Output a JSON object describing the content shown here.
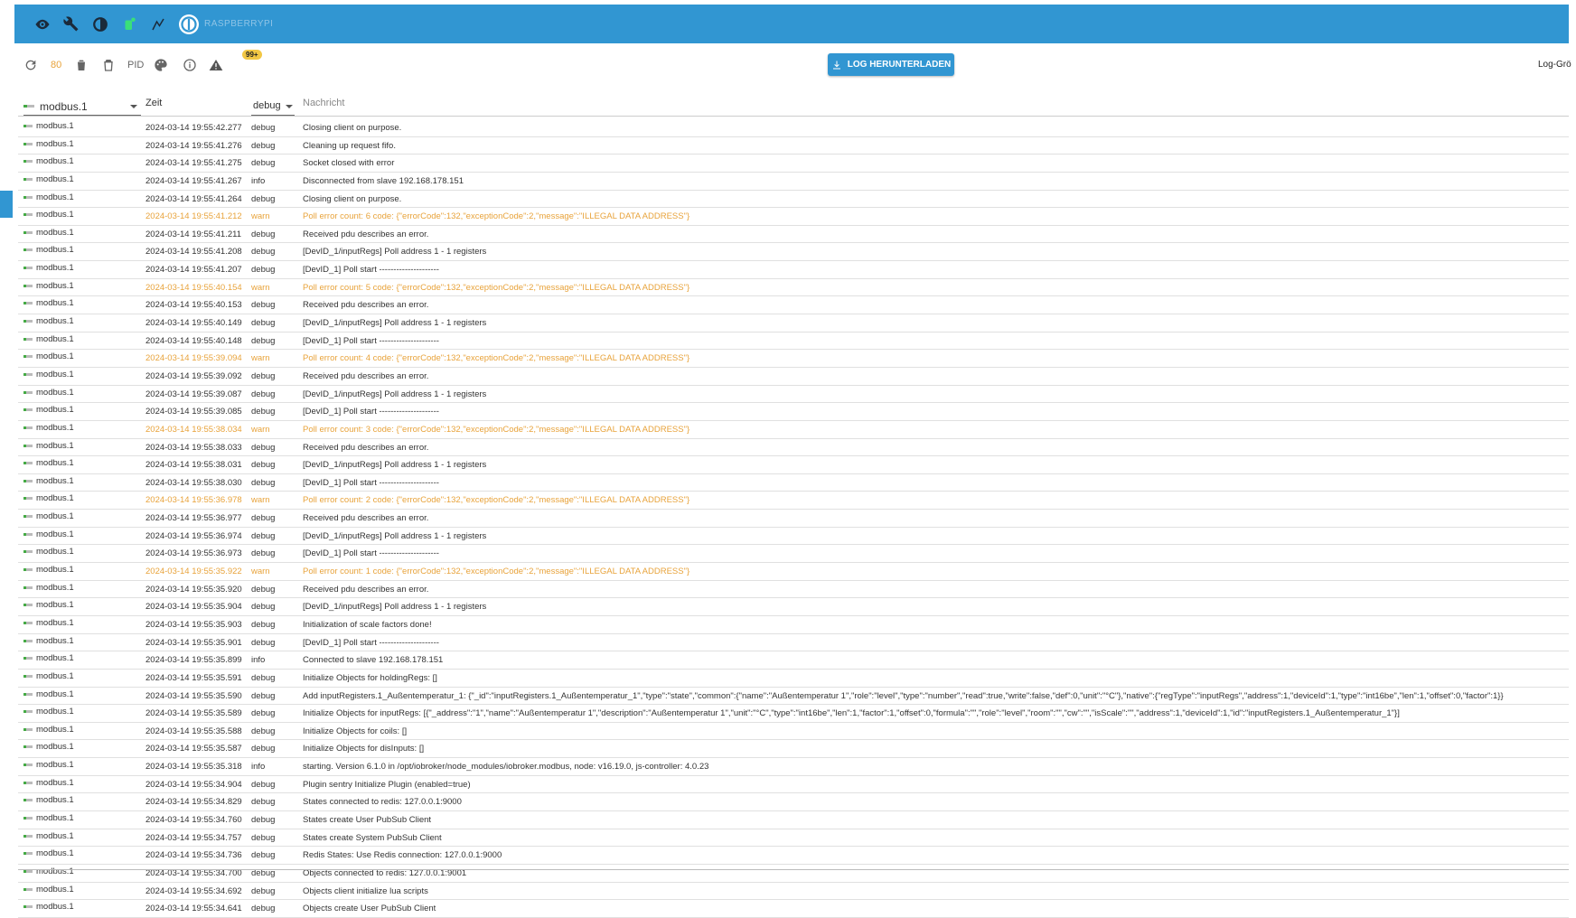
{
  "topbar": {
    "host_name": "RASPBERRYPI",
    "icons": [
      "eye-icon",
      "wrench-icon",
      "contrast-icon",
      "notification-icon",
      "expert-mode-icon",
      "host-logo-icon"
    ]
  },
  "toolbar": {
    "refresh_icon": "refresh-icon",
    "count": "80",
    "delete_icon": "trash-icon",
    "delete_all_icon": "trash-all-icon",
    "pid_label": "PID",
    "palette_icon": "palette-icon",
    "info_icon": "info-icon",
    "warn_icon": "warning-icon",
    "warn_badge": "99+",
    "download_label": "LOG HERUNTERLADEN",
    "log_size_label": "Log-Grö"
  },
  "header": {
    "source_value": "modbus.1",
    "time_label": "Zeit",
    "level_value": "debug",
    "message_placeholder": "Nachricht"
  },
  "colors": {
    "accent": "#3196d2",
    "warn": "#e8a33b",
    "badge": "#f2c744"
  },
  "rows": [
    {
      "src": "modbus.1",
      "time": "2024-03-14 19:55:42.277",
      "lvl": "debug",
      "msg": "Closing client on purpose."
    },
    {
      "src": "modbus.1",
      "time": "2024-03-14 19:55:41.276",
      "lvl": "debug",
      "msg": "Cleaning up request fifo."
    },
    {
      "src": "modbus.1",
      "time": "2024-03-14 19:55:41.275",
      "lvl": "debug",
      "msg": "Socket closed with error"
    },
    {
      "src": "modbus.1",
      "time": "2024-03-14 19:55:41.267",
      "lvl": "info",
      "msg": "Disconnected from slave 192.168.178.151"
    },
    {
      "src": "modbus.1",
      "time": "2024-03-14 19:55:41.264",
      "lvl": "debug",
      "msg": "Closing client on purpose."
    },
    {
      "src": "modbus.1",
      "time": "2024-03-14 19:55:41.212",
      "lvl": "warn",
      "msg": "Poll error count: 6 code: {\"errorCode\":132,\"exceptionCode\":2,\"message\":\"ILLEGAL DATA ADDRESS\"}"
    },
    {
      "src": "modbus.1",
      "time": "2024-03-14 19:55:41.211",
      "lvl": "debug",
      "msg": "Received pdu describes an error."
    },
    {
      "src": "modbus.1",
      "time": "2024-03-14 19:55:41.208",
      "lvl": "debug",
      "msg": "[DevID_1/inputRegs] Poll address 1 - 1 registers"
    },
    {
      "src": "modbus.1",
      "time": "2024-03-14 19:55:41.207",
      "lvl": "debug",
      "msg": "[DevID_1] Poll start ---------------------"
    },
    {
      "src": "modbus.1",
      "time": "2024-03-14 19:55:40.154",
      "lvl": "warn",
      "msg": "Poll error count: 5 code: {\"errorCode\":132,\"exceptionCode\":2,\"message\":\"ILLEGAL DATA ADDRESS\"}"
    },
    {
      "src": "modbus.1",
      "time": "2024-03-14 19:55:40.153",
      "lvl": "debug",
      "msg": "Received pdu describes an error."
    },
    {
      "src": "modbus.1",
      "time": "2024-03-14 19:55:40.149",
      "lvl": "debug",
      "msg": "[DevID_1/inputRegs] Poll address 1 - 1 registers"
    },
    {
      "src": "modbus.1",
      "time": "2024-03-14 19:55:40.148",
      "lvl": "debug",
      "msg": "[DevID_1] Poll start ---------------------"
    },
    {
      "src": "modbus.1",
      "time": "2024-03-14 19:55:39.094",
      "lvl": "warn",
      "msg": "Poll error count: 4 code: {\"errorCode\":132,\"exceptionCode\":2,\"message\":\"ILLEGAL DATA ADDRESS\"}"
    },
    {
      "src": "modbus.1",
      "time": "2024-03-14 19:55:39.092",
      "lvl": "debug",
      "msg": "Received pdu describes an error."
    },
    {
      "src": "modbus.1",
      "time": "2024-03-14 19:55:39.087",
      "lvl": "debug",
      "msg": "[DevID_1/inputRegs] Poll address 1 - 1 registers"
    },
    {
      "src": "modbus.1",
      "time": "2024-03-14 19:55:39.085",
      "lvl": "debug",
      "msg": "[DevID_1] Poll start ---------------------"
    },
    {
      "src": "modbus.1",
      "time": "2024-03-14 19:55:38.034",
      "lvl": "warn",
      "msg": "Poll error count: 3 code: {\"errorCode\":132,\"exceptionCode\":2,\"message\":\"ILLEGAL DATA ADDRESS\"}"
    },
    {
      "src": "modbus.1",
      "time": "2024-03-14 19:55:38.033",
      "lvl": "debug",
      "msg": "Received pdu describes an error."
    },
    {
      "src": "modbus.1",
      "time": "2024-03-14 19:55:38.031",
      "lvl": "debug",
      "msg": "[DevID_1/inputRegs] Poll address 1 - 1 registers"
    },
    {
      "src": "modbus.1",
      "time": "2024-03-14 19:55:38.030",
      "lvl": "debug",
      "msg": "[DevID_1] Poll start ---------------------"
    },
    {
      "src": "modbus.1",
      "time": "2024-03-14 19:55:36.978",
      "lvl": "warn",
      "msg": "Poll error count: 2 code: {\"errorCode\":132,\"exceptionCode\":2,\"message\":\"ILLEGAL DATA ADDRESS\"}"
    },
    {
      "src": "modbus.1",
      "time": "2024-03-14 19:55:36.977",
      "lvl": "debug",
      "msg": "Received pdu describes an error."
    },
    {
      "src": "modbus.1",
      "time": "2024-03-14 19:55:36.974",
      "lvl": "debug",
      "msg": "[DevID_1/inputRegs] Poll address 1 - 1 registers"
    },
    {
      "src": "modbus.1",
      "time": "2024-03-14 19:55:36.973",
      "lvl": "debug",
      "msg": "[DevID_1] Poll start ---------------------"
    },
    {
      "src": "modbus.1",
      "time": "2024-03-14 19:55:35.922",
      "lvl": "warn",
      "msg": "Poll error count: 1 code: {\"errorCode\":132,\"exceptionCode\":2,\"message\":\"ILLEGAL DATA ADDRESS\"}"
    },
    {
      "src": "modbus.1",
      "time": "2024-03-14 19:55:35.920",
      "lvl": "debug",
      "msg": "Received pdu describes an error."
    },
    {
      "src": "modbus.1",
      "time": "2024-03-14 19:55:35.904",
      "lvl": "debug",
      "msg": "[DevID_1/inputRegs] Poll address 1 - 1 registers"
    },
    {
      "src": "modbus.1",
      "time": "2024-03-14 19:55:35.903",
      "lvl": "debug",
      "msg": "Initialization of scale factors done!"
    },
    {
      "src": "modbus.1",
      "time": "2024-03-14 19:55:35.901",
      "lvl": "debug",
      "msg": "[DevID_1] Poll start ---------------------"
    },
    {
      "src": "modbus.1",
      "time": "2024-03-14 19:55:35.899",
      "lvl": "info",
      "msg": "Connected to slave 192.168.178.151"
    },
    {
      "src": "modbus.1",
      "time": "2024-03-14 19:55:35.591",
      "lvl": "debug",
      "msg": "Initialize Objects for holdingRegs: []"
    },
    {
      "src": "modbus.1",
      "time": "2024-03-14 19:55:35.590",
      "lvl": "debug",
      "msg": "Add inputRegisters.1_Außentemperatur_1: {\"_id\":\"inputRegisters.1_Außentemperatur_1\",\"type\":\"state\",\"common\":{\"name\":\"Außentemperatur 1\",\"role\":\"level\",\"type\":\"number\",\"read\":true,\"write\":false,\"def\":0,\"unit\":\"°C\"},\"native\":{\"regType\":\"inputRegs\",\"address\":1,\"deviceId\":1,\"type\":\"int16be\",\"len\":1,\"offset\":0,\"factor\":1}}"
    },
    {
      "src": "modbus.1",
      "time": "2024-03-14 19:55:35.589",
      "lvl": "debug",
      "msg": "Initialize Objects for inputRegs: [{\"_address\":\"1\",\"name\":\"Außentemperatur 1\",\"description\":\"Außentemperatur 1\",\"unit\":\"°C\",\"type\":\"int16be\",\"len\":1,\"factor\":1,\"offset\":0,\"formula\":\"\",\"role\":\"level\",\"room\":\"\",\"cw\":\"\",\"isScale\":\"\",\"address\":1,\"deviceId\":1,\"id\":\"inputRegisters.1_Außentemperatur_1\"}]"
    },
    {
      "src": "modbus.1",
      "time": "2024-03-14 19:55:35.588",
      "lvl": "debug",
      "msg": "Initialize Objects for coils: []"
    },
    {
      "src": "modbus.1",
      "time": "2024-03-14 19:55:35.587",
      "lvl": "debug",
      "msg": "Initialize Objects for disInputs: []"
    },
    {
      "src": "modbus.1",
      "time": "2024-03-14 19:55:35.318",
      "lvl": "info",
      "msg": "starting. Version 6.1.0 in /opt/iobroker/node_modules/iobroker.modbus, node: v16.19.0, js-controller: 4.0.23"
    },
    {
      "src": "modbus.1",
      "time": "2024-03-14 19:55:34.904",
      "lvl": "debug",
      "msg": "Plugin sentry Initialize Plugin (enabled=true)"
    },
    {
      "src": "modbus.1",
      "time": "2024-03-14 19:55:34.829",
      "lvl": "debug",
      "msg": "States connected to redis: 127.0.0.1:9000"
    },
    {
      "src": "modbus.1",
      "time": "2024-03-14 19:55:34.760",
      "lvl": "debug",
      "msg": "States create User PubSub Client"
    },
    {
      "src": "modbus.1",
      "time": "2024-03-14 19:55:34.757",
      "lvl": "debug",
      "msg": "States create System PubSub Client"
    },
    {
      "src": "modbus.1",
      "time": "2024-03-14 19:55:34.736",
      "lvl": "debug",
      "msg": "Redis States: Use Redis connection: 127.0.0.1:9000"
    },
    {
      "src": "modbus.1",
      "time": "2024-03-14 19:55:34.700",
      "lvl": "debug",
      "msg": "Objects connected to redis: 127.0.0.1:9001"
    },
    {
      "src": "modbus.1",
      "time": "2024-03-14 19:55:34.692",
      "lvl": "debug",
      "msg": "Objects client initialize lua scripts"
    },
    {
      "src": "modbus.1",
      "time": "2024-03-14 19:55:34.641",
      "lvl": "debug",
      "msg": "Objects create User PubSub Client"
    }
  ]
}
